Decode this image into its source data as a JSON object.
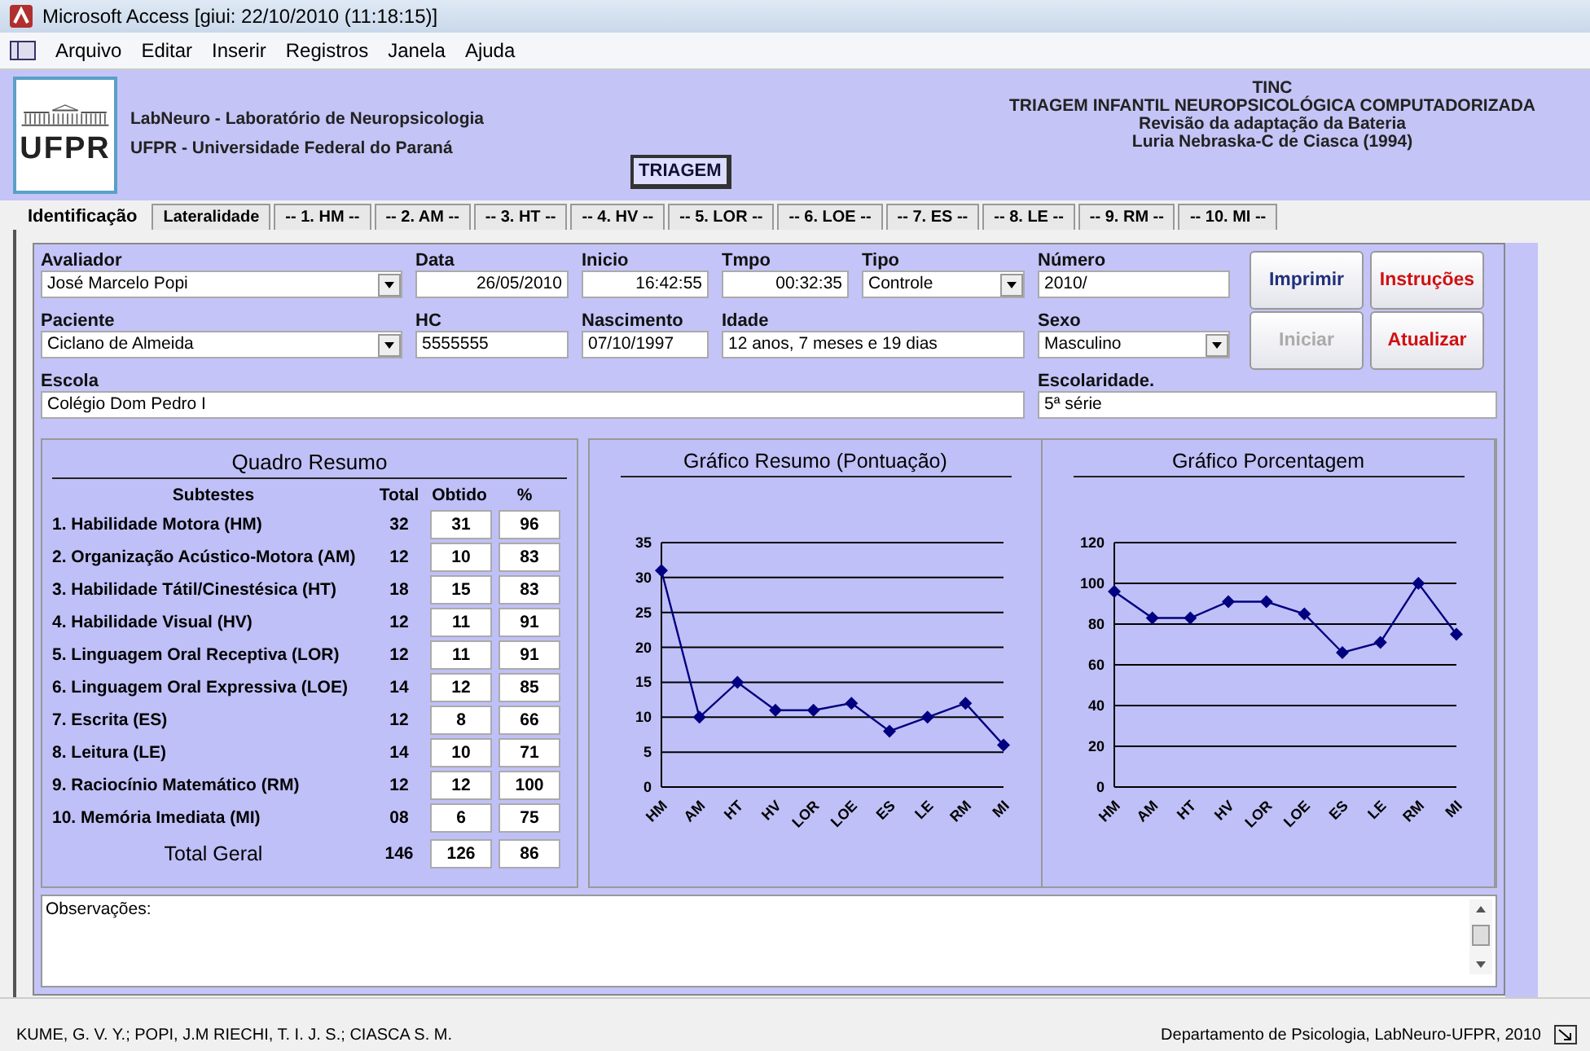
{
  "window": {
    "title": "Microsoft Access  [giui: 22/10/2010  (11:18:15)]"
  },
  "menu": [
    "Arquivo",
    "Editar",
    "Inserir",
    "Registros",
    "Janela",
    "Ajuda"
  ],
  "header": {
    "logo_text": "UFPR",
    "lab": "LabNeuro - Laboratório de Neuropsicologia",
    "university": "UFPR - Universidade Federal do Paraná",
    "badge": "TRIAGEM",
    "title_lines": [
      "TINC",
      "TRIAGEM INFANTIL NEUROPSICOLÓGICA COMPUTADORIZADA",
      "Revisão da adaptação da Bateria",
      "Luria   Nebraska-C de Ciasca (1994)"
    ]
  },
  "tabs": [
    {
      "label": "Identificação",
      "selected": true
    },
    {
      "label": "Lateralidade",
      "selected": false
    },
    {
      "label": "-- 1. HM --",
      "selected": false
    },
    {
      "label": "-- 2. AM --",
      "selected": false
    },
    {
      "label": "-- 3. HT --",
      "selected": false
    },
    {
      "label": "-- 4. HV --",
      "selected": false
    },
    {
      "label": "-- 5. LOR --",
      "selected": false
    },
    {
      "label": "-- 6. LOE --",
      "selected": false
    },
    {
      "label": "-- 7. ES --",
      "selected": false
    },
    {
      "label": "-- 8. LE --",
      "selected": false
    },
    {
      "label": "-- 9. RM --",
      "selected": false
    },
    {
      "label": "-- 10. MI --",
      "selected": false
    }
  ],
  "fields": [
    {
      "label": "Avaliador",
      "value": "José Marcelo Popi",
      "kind": "combo"
    },
    {
      "label": "Data",
      "value": "26/05/2010",
      "kind": "right"
    },
    {
      "label": "Inicio",
      "value": "16:42:55",
      "kind": "right"
    },
    {
      "label": "Tmpo",
      "value": "00:32:35",
      "kind": "right"
    },
    {
      "label": "Tipo",
      "value": "Controle",
      "kind": "combo"
    },
    {
      "label": "Número",
      "value": "2010/",
      "kind": "text"
    },
    {
      "label": "Paciente",
      "value": "Ciclano de Almeida",
      "kind": "combo"
    },
    {
      "label": "HC",
      "value": "5555555",
      "kind": "text"
    },
    {
      "label": "Nascimento",
      "value": "07/10/1997",
      "kind": "text"
    },
    {
      "label": "Idade",
      "value": "12 anos, 7 meses e 19 dias",
      "kind": "text"
    },
    {
      "label": "Sexo",
      "value": "Masculino",
      "kind": "combo"
    },
    {
      "label": "Escola",
      "value": "Colégio Dom Pedro I",
      "kind": "text"
    },
    {
      "label": "Escolaridade.",
      "value": "5ª série",
      "kind": "text"
    }
  ],
  "buttons": [
    {
      "label": "Imprimir",
      "kind": "primary",
      "disabled": false
    },
    {
      "label": "Instruções",
      "kind": "danger",
      "disabled": false
    },
    {
      "label": "Iniciar",
      "kind": "primary",
      "disabled": true
    },
    {
      "label": "Atualizar",
      "kind": "danger",
      "disabled": false
    }
  ],
  "summary": {
    "title": "Quadro Resumo",
    "columns": [
      "Subtestes",
      "Total",
      "Obtido",
      "%"
    ],
    "rows": [
      {
        "name": "1. Habilidade Motora (HM)",
        "total": "32",
        "obtained": "31",
        "percent": "96"
      },
      {
        "name": "2. Organização Acústico-Motora (AM)",
        "total": "12",
        "obtained": "10",
        "percent": "83"
      },
      {
        "name": "3. Habilidade Tátil/Cinestésica (HT)",
        "total": "18",
        "obtained": "15",
        "percent": "83"
      },
      {
        "name": "4. Habilidade Visual (HV)",
        "total": "12",
        "obtained": "11",
        "percent": "91"
      },
      {
        "name": "5. Linguagem Oral Receptiva (LOR)",
        "total": "12",
        "obtained": "11",
        "percent": "91"
      },
      {
        "name": "6. Linguagem Oral Expressiva (LOE)",
        "total": "14",
        "obtained": "12",
        "percent": "85"
      },
      {
        "name": "7. Escrita (ES)",
        "total": "12",
        "obtained": "8",
        "percent": "66"
      },
      {
        "name": "8. Leitura (LE)",
        "total": "14",
        "obtained": "10",
        "percent": "71"
      },
      {
        "name": "9. Raciocínio Matemático (RM)",
        "total": "12",
        "obtained": "12",
        "percent": "100"
      },
      {
        "name": "10. Memória Imediata (MI)",
        "total": "08",
        "obtained": "6",
        "percent": "75"
      }
    ],
    "total": {
      "name": "Total Geral",
      "total": "146",
      "obtained": "126",
      "percent": "86"
    }
  },
  "charts": [
    {
      "chart_data": {
        "type": "line",
        "title": "Gráfico Resumo (Pontuação)",
        "categories": [
          "HM",
          "AM",
          "HT",
          "HV",
          "LOR",
          "LOE",
          "ES",
          "LE",
          "RM",
          "MI"
        ],
        "grid": true,
        "series": [
          {
            "color": "#000080",
            "marker": "diamond",
            "values": [
              31,
              10,
              15,
              11,
              11,
              12,
              8,
              10,
              12,
              6
            ]
          }
        ],
        "ylim": [
          0,
          35
        ],
        "yticks": [
          0,
          5,
          10,
          15,
          20,
          25,
          30,
          35
        ]
      }
    },
    {
      "chart_data": {
        "type": "line",
        "title": "Gráfico Porcentagem",
        "categories": [
          "HM",
          "AM",
          "HT",
          "HV",
          "LOR",
          "LOE",
          "ES",
          "LE",
          "RM",
          "MI"
        ],
        "grid": true,
        "series": [
          {
            "color": "#000080",
            "marker": "diamond",
            "values": [
              96,
              83,
              83,
              91,
              91,
              85,
              66,
              71,
              100,
              75
            ]
          }
        ],
        "ylim": [
          0,
          120
        ],
        "yticks": [
          0,
          20,
          40,
          60,
          80,
          100,
          120
        ]
      }
    }
  ],
  "notes": {
    "value": "Observações:"
  },
  "status_bar": {
    "left": "KUME, G. V. Y.; POPI, J.M  RIECHI, T. I. J. S.; CIASCA S. M.",
    "right": "Departamento de Psicologia, LabNeuro-UFPR, 2010"
  }
}
